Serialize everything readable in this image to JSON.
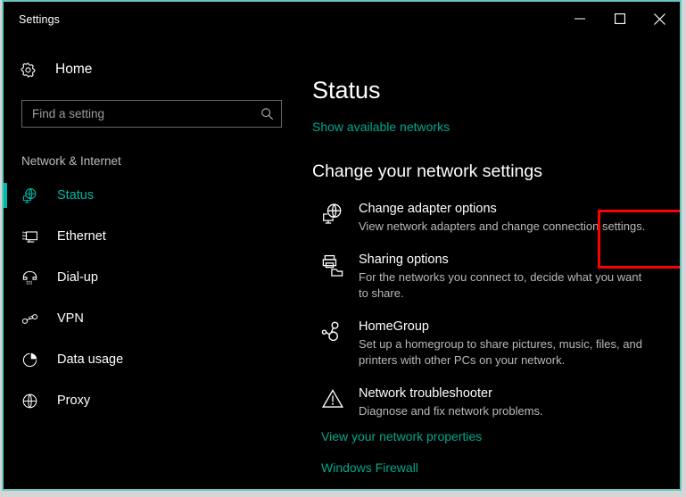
{
  "window": {
    "title": "Settings",
    "accent_color": "#00b7a8",
    "border_color": "#63c6c0",
    "highlight_color": "#ff0000",
    "background_color": "#000000",
    "controls": {
      "minimize": "Minimize",
      "maximize": "Maximize",
      "close": "Close"
    }
  },
  "sidebar": {
    "home": {
      "label": "Home",
      "icon": "gear-icon"
    },
    "search": {
      "value": "",
      "placeholder": "Find a setting",
      "icon": "search-icon"
    },
    "category": "Network & Internet",
    "items": [
      {
        "label": "Status",
        "icon": "network-status-icon",
        "selected": true
      },
      {
        "label": "Ethernet",
        "icon": "ethernet-icon",
        "selected": false
      },
      {
        "label": "Dial-up",
        "icon": "phone-icon",
        "selected": false
      },
      {
        "label": "VPN",
        "icon": "vpn-key-icon",
        "selected": false
      },
      {
        "label": "Data usage",
        "icon": "pie-chart-icon",
        "selected": false
      },
      {
        "label": "Proxy",
        "icon": "globe-icon",
        "selected": false
      }
    ]
  },
  "main": {
    "title": "Status",
    "show_networks_link": "Show available networks",
    "section_heading": "Change your network settings",
    "options": [
      {
        "title": "Change adapter options",
        "desc": "View network adapters and change connection settings.",
        "icon": "network-adapter-icon",
        "highlighted": true
      },
      {
        "title": "Sharing options",
        "desc": "For the networks you connect to, decide what you want to share.",
        "icon": "sharing-icon",
        "highlighted": false
      },
      {
        "title": "HomeGroup",
        "desc": "Set up a homegroup to share pictures, music, files, and printers with other PCs on your network.",
        "icon": "homegroup-icon",
        "highlighted": false
      },
      {
        "title": "Network troubleshooter",
        "desc": "Diagnose and fix network problems.",
        "icon": "warning-triangle-icon",
        "highlighted": false
      }
    ],
    "links": [
      {
        "label": "View your network properties"
      },
      {
        "label": "Windows Firewall"
      }
    ]
  }
}
